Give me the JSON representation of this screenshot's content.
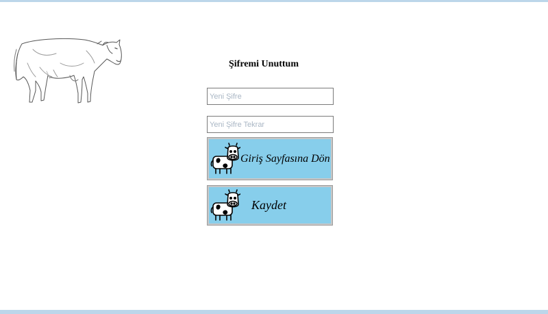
{
  "page": {
    "title": "Şifremi Unuttum",
    "accent_color": "#bcd6ea",
    "button_color": "#87ceeb"
  },
  "form": {
    "new_password": {
      "value": "",
      "placeholder": "Yeni Şifre"
    },
    "new_password_confirm": {
      "value": "",
      "placeholder": "Yeni Şifre Tekrar"
    }
  },
  "buttons": {
    "back_label": "Giriş Sayfasına Dön",
    "save_label": "Kaydet",
    "icon": "cow-icon"
  },
  "illustration": "cow-drawing"
}
